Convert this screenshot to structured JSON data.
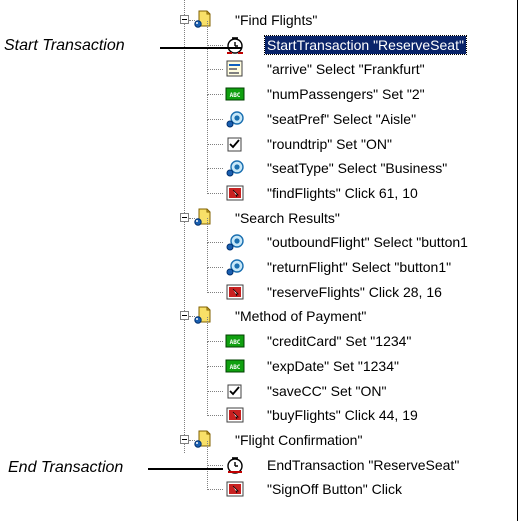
{
  "annotations": {
    "start": "Start Transaction",
    "end": "End Transaction"
  },
  "tree": [
    {
      "label": "\"Find Flights\"",
      "type": "group",
      "icon": "page-folder-icon"
    },
    {
      "label": "StartTransaction \"ReserveSeat\"",
      "type": "step",
      "icon": "transaction-start-icon",
      "selected": true
    },
    {
      "label": "\"arrive\" Select \"Frankfurt\"",
      "type": "step",
      "icon": "list-select-icon"
    },
    {
      "label": "\"numPassengers\" Set \"2\"",
      "type": "step",
      "icon": "edit-field-icon"
    },
    {
      "label": "\"seatPref\" Select \"Aisle\"",
      "type": "step",
      "icon": "radio-select-icon"
    },
    {
      "label": "\"roundtrip\" Set \"ON\"",
      "type": "step",
      "icon": "checkbox-icon"
    },
    {
      "label": "\"seatType\" Select \"Business\"",
      "type": "step",
      "icon": "radio-select-icon"
    },
    {
      "label": "\"findFlights\" Click 61, 10",
      "type": "step",
      "icon": "image-click-icon"
    },
    {
      "label": "\"Search Results\"",
      "type": "group",
      "icon": "page-folder-icon"
    },
    {
      "label": "\"outboundFlight\" Select \"button1",
      "type": "step",
      "icon": "radio-select-icon"
    },
    {
      "label": "\"returnFlight\" Select \"button1\"",
      "type": "step",
      "icon": "radio-select-icon"
    },
    {
      "label": "\"reserveFlights\" Click 28, 16",
      "type": "step",
      "icon": "image-click-icon"
    },
    {
      "label": "\"Method of Payment\"",
      "type": "group",
      "icon": "page-folder-icon"
    },
    {
      "label": "\"creditCard\" Set \"1234\"",
      "type": "step",
      "icon": "edit-field-icon"
    },
    {
      "label": "\"expDate\" Set \"1234\"",
      "type": "step",
      "icon": "edit-field-icon"
    },
    {
      "label": "\"saveCC\" Set \"ON\"",
      "type": "step",
      "icon": "checkbox-icon"
    },
    {
      "label": "\"buyFlights\" Click 44, 19",
      "type": "step",
      "icon": "image-click-icon"
    },
    {
      "label": "\"Flight Confirmation\"",
      "type": "group",
      "icon": "page-folder-icon"
    },
    {
      "label": "EndTransaction \"ReserveSeat\"",
      "type": "step",
      "icon": "transaction-end-icon"
    },
    {
      "label": "\"SignOff Button\" Click",
      "type": "step",
      "icon": "image-click-icon"
    }
  ],
  "colors": {
    "selection": "#0a246a",
    "selection_text": "#ffffff",
    "page_icon": "#f8e068",
    "radio_icon": "#1a6fb0",
    "edit_icon": "#10a010",
    "click_icon": "#c82020"
  }
}
